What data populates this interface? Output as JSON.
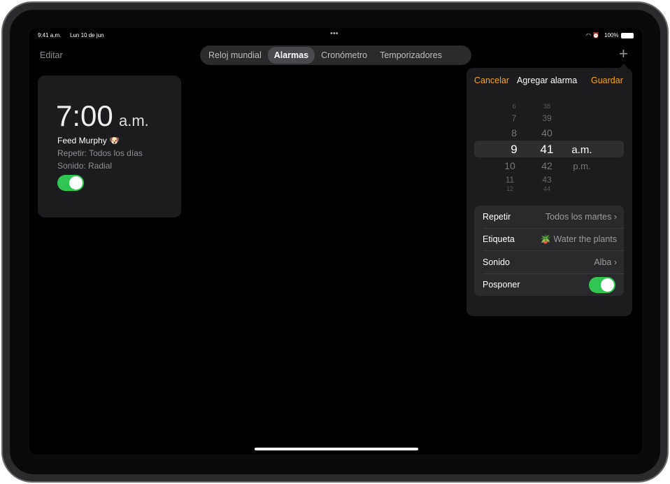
{
  "status_bar": {
    "time": "9:41 a.m.",
    "date": "Lun 10 de jun",
    "dots": "•••",
    "battery": "100%"
  },
  "nav": {
    "edit_label": "Editar",
    "add_label": "+",
    "tabs": [
      {
        "label": "Reloj mundial"
      },
      {
        "label": "Alarmas",
        "active": true
      },
      {
        "label": "Cronómetro"
      },
      {
        "label": "Temporizadores"
      }
    ]
  },
  "alarm": {
    "time": "7:00",
    "period": "a.m.",
    "label": "Feed Murphy 🐶",
    "repeat": "Repetir: Todos los días",
    "sound": "Sonido: Radial",
    "enabled": true
  },
  "add_alarm": {
    "cancel": "Cancelar",
    "title": "Agregar alarma",
    "save": "Guardar",
    "picker": {
      "hours": [
        "6",
        "7",
        "8",
        "9",
        "10",
        "11",
        "12"
      ],
      "minutes": [
        "38",
        "39",
        "40",
        "41",
        "42",
        "43",
        "44"
      ],
      "periods": [
        "a.m.",
        "p.m."
      ],
      "selected_hour": "9",
      "selected_minute": "41",
      "selected_period": "a.m."
    },
    "options": {
      "repeat_label": "Repetir",
      "repeat_value": "Todos los martes ›",
      "label_label": "Etiqueta",
      "label_value": "🪴 Water the plants",
      "sound_label": "Sonido",
      "sound_value": "Alba ›",
      "snooze_label": "Posponer",
      "snooze_on": true
    }
  },
  "colors": {
    "accent": "#f5a30a",
    "toggle_on": "#30c552"
  }
}
